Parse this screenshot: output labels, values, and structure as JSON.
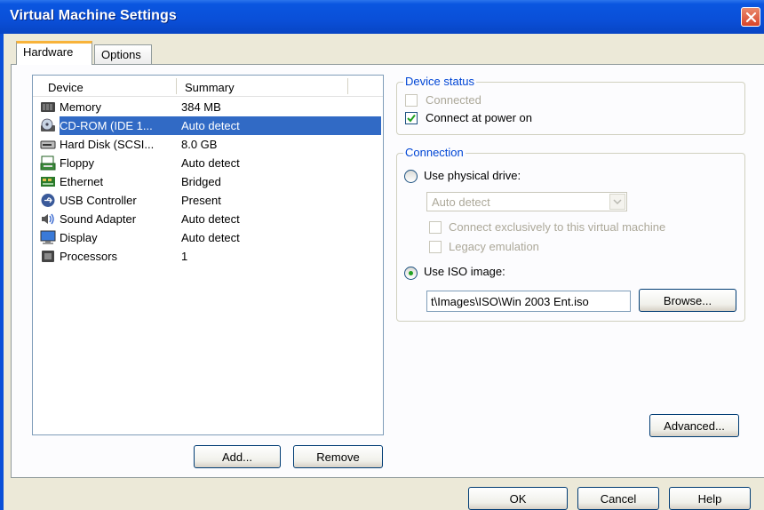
{
  "window": {
    "title": "Virtual Machine Settings"
  },
  "tabs": [
    {
      "label": "Hardware"
    },
    {
      "label": "Options"
    }
  ],
  "device_list": {
    "columns": [
      "Device",
      "Summary"
    ],
    "rows": [
      {
        "name": "Memory",
        "summary": "384 MB",
        "icon": "memory-icon"
      },
      {
        "name": "CD-ROM (IDE 1...",
        "summary": "Auto detect",
        "icon": "cdrom-icon",
        "selected": true
      },
      {
        "name": "Hard Disk (SCSI...",
        "summary": "8.0 GB",
        "icon": "hard-disk-icon"
      },
      {
        "name": "Floppy",
        "summary": "Auto detect",
        "icon": "floppy-icon"
      },
      {
        "name": "Ethernet",
        "summary": "Bridged",
        "icon": "ethernet-icon"
      },
      {
        "name": "USB Controller",
        "summary": "Present",
        "icon": "usb-icon"
      },
      {
        "name": "Sound Adapter",
        "summary": "Auto detect",
        "icon": "sound-icon"
      },
      {
        "name": "Display",
        "summary": "Auto detect",
        "icon": "display-icon"
      },
      {
        "name": "Processors",
        "summary": "1",
        "icon": "processor-icon"
      }
    ]
  },
  "list_buttons": {
    "add": "Add...",
    "remove": "Remove"
  },
  "device_status": {
    "legend": "Device status",
    "connected": {
      "label": "Connected",
      "checked": false,
      "enabled": false
    },
    "connect_at_power_on": {
      "label": "Connect at power on",
      "checked": true,
      "enabled": true
    }
  },
  "connection": {
    "legend": "Connection",
    "physical_drive": {
      "label": "Use physical drive:",
      "selected": false
    },
    "drive_select": {
      "value": "Auto detect"
    },
    "connect_exclusively": {
      "label": "Connect exclusively to this virtual machine",
      "checked": false,
      "enabled": false
    },
    "legacy_emulation": {
      "label": "Legacy emulation",
      "checked": false,
      "enabled": false
    },
    "iso_image": {
      "label": "Use ISO image:",
      "selected": true
    },
    "iso_path": "t\\Images\\ISO\\Win 2003 Ent.iso",
    "browse": "Browse..."
  },
  "advanced_button": "Advanced...",
  "dialog_buttons": {
    "ok": "OK",
    "cancel": "Cancel",
    "help": "Help"
  },
  "colors": {
    "title_bar": "#0a4fd8",
    "selection": "#316ac5",
    "group_legend": "#0046d5",
    "check_mark": "#21a121"
  }
}
